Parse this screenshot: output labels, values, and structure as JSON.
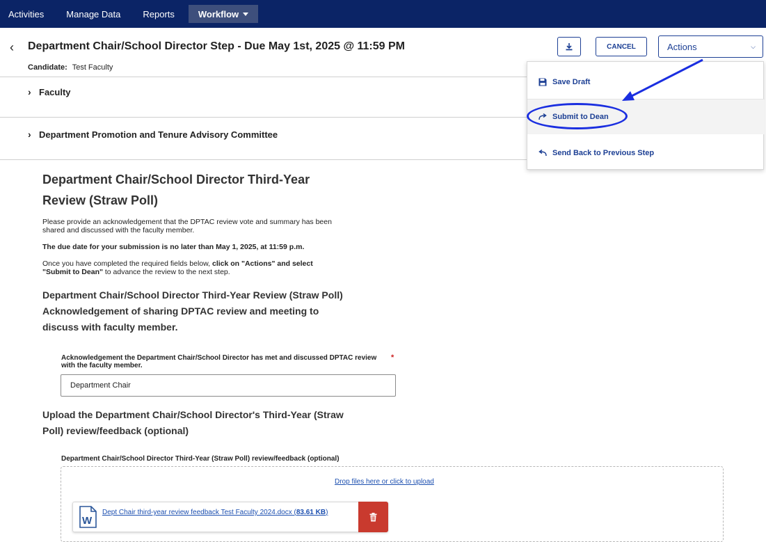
{
  "nav": {
    "items": [
      "Activities",
      "Manage Data",
      "Reports"
    ],
    "active": "Workflow"
  },
  "header": {
    "title": "Department Chair/School Director Step - Due May 1st, 2025 @ 11:59 PM",
    "candidate_label": "Candidate:",
    "candidate_value": "Test Faculty",
    "cancel_label": "CANCEL",
    "actions_label": "Actions"
  },
  "sections": [
    "Faculty",
    "Department Promotion and Tenure Advisory Committee"
  ],
  "actions_menu": {
    "items": [
      {
        "label": "Save Draft",
        "icon": "save-icon"
      },
      {
        "label": "Submit to Dean",
        "icon": "redo-arrow-icon"
      },
      {
        "label": "Send Back to Previous Step",
        "icon": "undo-arrow-icon"
      }
    ]
  },
  "annotation": {
    "arrow_color": "#1a2ee0"
  },
  "form": {
    "title": "Department Chair/School Director Third-Year Review (Straw Poll)",
    "intro": "Please provide an acknowledgement that the DPTAC review vote and summary has been shared and discussed with the faculty member.",
    "due_note": "The due date for your submission is no later than May 1, 2025, at 11:59 p.m.",
    "instructions_pre": "Once you have completed the required fields below, ",
    "instructions_bold": "click on \"Actions\" and select \"Submit to Dean\"",
    "instructions_post": " to advance the review to the next step.",
    "ack_heading": "Department Chair/School Director Third-Year Review (Straw Poll) Acknowledgement of sharing DPTAC review and meeting to discuss with faculty member.",
    "ack_field_label": "Acknowledgement the Department Chair/School Director has met and discussed DPTAC review with the faculty member.",
    "ack_required": "*",
    "ack_value": "Department Chair",
    "upload_heading": "Upload the Department Chair/School Director's Third-Year (Straw Poll) review/feedback (optional)",
    "upload_field_label": "Department Chair/School Director Third-Year (Straw Poll) review/feedback (optional)",
    "drop_text": "Drop files here or click to upload",
    "file_name": "Dept Chair third-year review feedback Test Faculty 2024.docx (",
    "file_size": "83.61 KB",
    "file_close": ")"
  },
  "colors": {
    "nav_bg": "#0b2466",
    "accent": "#1c3f94",
    "delete": "#c93a2e"
  }
}
